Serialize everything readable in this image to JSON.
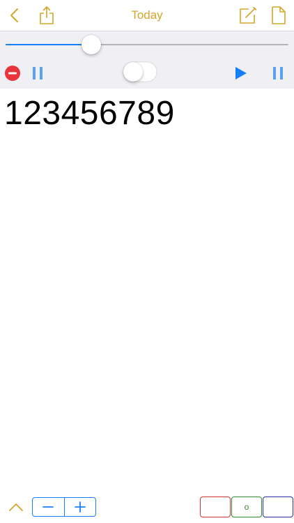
{
  "colors": {
    "accent_gold": "#d4a52c",
    "blue": "#157efb",
    "pause_blue": "#5aa0f0",
    "stop_red": "#e8343a",
    "red_box": "#d0312d",
    "green_box": "#2e8b2e",
    "navy_box": "#2b2b9c"
  },
  "navbar": {
    "title": "Today",
    "back_icon": "chevron-left-icon",
    "share_icon": "share-icon",
    "compose_icon": "compose-icon",
    "document_icon": "document-icon"
  },
  "slider": {
    "value": 0.303
  },
  "controls": {
    "stop_icon": "minus-circle-icon",
    "pause_icon": "pause-icon",
    "toggle_on": false,
    "play_icon": "play-icon",
    "pause_right_icon": "pause-icon"
  },
  "content": {
    "text": "123456789"
  },
  "bottombar": {
    "collapse_icon": "chevron-up-icon",
    "decrease_icon": "minus-icon",
    "increase_icon": "plus-icon",
    "color_boxes": [
      {
        "label": "",
        "color": "red"
      },
      {
        "label": "o",
        "color": "green"
      },
      {
        "label": "",
        "color": "navy"
      }
    ]
  }
}
